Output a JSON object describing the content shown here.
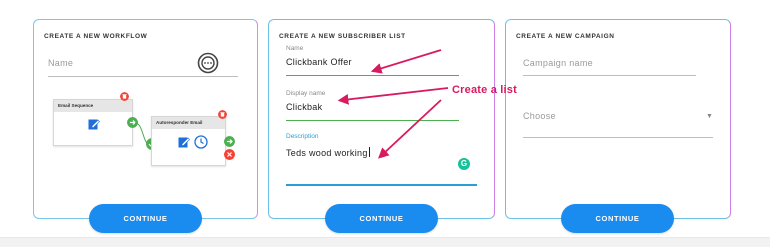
{
  "workflow": {
    "title": "CREATE A NEW WORKFLOW",
    "name_placeholder": "Name",
    "diagram": {
      "node1_label": "Email Sequence",
      "node2_label": "Autoresponder Email"
    },
    "continue_label": "CONTINUE"
  },
  "subscriber_list": {
    "title": "CREATE A NEW SUBSCRIBER LIST",
    "name_label": "Name",
    "name_value": "Clickbank Offer",
    "display_label": "Display name",
    "display_value": "Clickbak",
    "description_label": "Description",
    "description_value": "Teds wood working",
    "continue_label": "CONTINUE"
  },
  "campaign": {
    "title": "CREATE A NEW CAMPAIGN",
    "name_placeholder": "Campaign name",
    "select_placeholder": "Choose",
    "continue_label": "CONTINUE"
  },
  "annotation": {
    "text": "Create a list",
    "color": "#d81b60"
  },
  "colors": {
    "button": "#1a8cf0",
    "success": "#4caf50",
    "danger": "#f44336",
    "accent": "#2a9fd6"
  }
}
